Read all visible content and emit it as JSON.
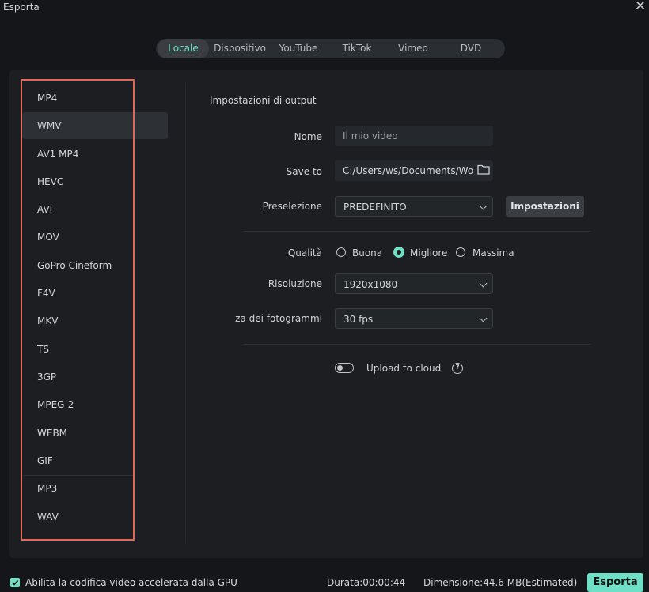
{
  "window": {
    "title": "Esporta"
  },
  "tabs": [
    {
      "label": "Locale",
      "active": true
    },
    {
      "label": "Dispositivo",
      "active": false
    },
    {
      "label": "YouTube",
      "active": false
    },
    {
      "label": "TikTok",
      "active": false
    },
    {
      "label": "Vimeo",
      "active": false
    },
    {
      "label": "DVD",
      "active": false
    }
  ],
  "formats": [
    {
      "label": "MP4",
      "selected": false
    },
    {
      "label": "WMV",
      "selected": true
    },
    {
      "label": "AV1 MP4",
      "selected": false
    },
    {
      "label": "HEVC",
      "selected": false
    },
    {
      "label": "AVI",
      "selected": false
    },
    {
      "label": "MOV",
      "selected": false
    },
    {
      "label": "GoPro Cineform",
      "selected": false
    },
    {
      "label": "F4V",
      "selected": false
    },
    {
      "label": "MKV",
      "selected": false
    },
    {
      "label": "TS",
      "selected": false
    },
    {
      "label": "3GP",
      "selected": false
    },
    {
      "label": "MPEG-2",
      "selected": false
    },
    {
      "label": "WEBM",
      "selected": false
    },
    {
      "label": "GIF",
      "selected": false
    },
    {
      "label": "MP3",
      "selected": false
    },
    {
      "label": "WAV",
      "selected": false
    }
  ],
  "output": {
    "section_title": "Impostazioni di output",
    "name_label": "Nome",
    "name_placeholder": "Il mio video",
    "saveto_label": "Save to",
    "saveto_value": "C:/Users/ws/Documents/Wo",
    "preset_label": "Preselezione",
    "preset_value": "PREDEFINITO",
    "settings_button": "Impostazioni",
    "quality_label": "Qualità",
    "quality_options": [
      {
        "label": "Buona",
        "selected": false
      },
      {
        "label": "Migliore",
        "selected": true
      },
      {
        "label": "Massima",
        "selected": false
      }
    ],
    "resolution_label": "Risoluzione",
    "resolution_value": "1920x1080",
    "framerate_label": "za dei fotogrammi",
    "framerate_value": "30 fps",
    "upload_label": "Upload to cloud",
    "upload_enabled": false
  },
  "footer": {
    "gpu_label": "Abilita la codifica video accelerata dalla GPU",
    "gpu_checked": true,
    "duration": "Durata:00:00:44",
    "size": "Dimensione:44.6 MB(Estimated)",
    "export_button": "Esporta"
  },
  "colors": {
    "accent": "#6fe0c6",
    "highlight_border": "#e0695c"
  }
}
